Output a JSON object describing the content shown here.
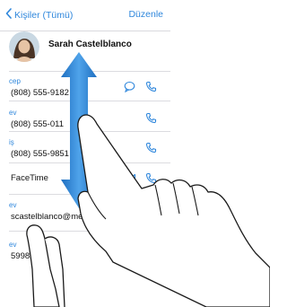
{
  "nav": {
    "back_label": "Kişiler (Tümü)",
    "edit_label": "Düzenle"
  },
  "contact": {
    "name": "Sarah Castelblanco"
  },
  "fields": [
    {
      "label": "cep",
      "value": "(808) 555-9182",
      "actions": [
        "message-icon",
        "phone-icon"
      ]
    },
    {
      "label": "ev",
      "value": "(808) 555-011",
      "actions": [
        "phone-icon"
      ]
    },
    {
      "label": "iş",
      "value": "(808) 555-9851",
      "actions": [
        "phone-icon"
      ]
    },
    {
      "label": "",
      "value": "FaceTime",
      "actions": [
        "video-icon",
        "phone-icon"
      ]
    },
    {
      "label": "ev",
      "value": "scastelblanco@me.com",
      "actions": []
    },
    {
      "label": "ev",
      "value": "5998  Hilo, HI",
      "actions": []
    }
  ],
  "colors": {
    "accent": "#2f87dc",
    "arrow": "#2b7fd2",
    "divider": "#dcdce0"
  },
  "gesture": {
    "type": "vertical-swipe",
    "icons": [
      "double-arrow-icon",
      "hand-icon",
      "hand-icon"
    ]
  }
}
